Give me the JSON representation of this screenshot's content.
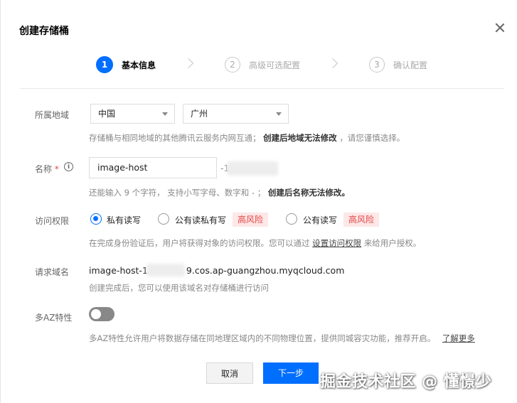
{
  "dialog": {
    "title": "创建存储桶"
  },
  "steps": [
    {
      "num": "1",
      "label": "基本信息"
    },
    {
      "num": "2",
      "label": "高级可选配置"
    },
    {
      "num": "3",
      "label": "确认配置"
    }
  ],
  "region": {
    "label": "所属地域",
    "country_value": "中国",
    "city_value": "广州",
    "hint_pre": "存储桶与相同地域的其他腾讯云服务内网互通；",
    "hint_bold": "创建后地域无法修改",
    "hint_post": "，请您谨慎选择。"
  },
  "name": {
    "label": "名称",
    "required_mark": "*",
    "info_glyph": "i",
    "value": "image-host",
    "suffix": "-1",
    "hint_pre": "还能输入 9 个字符， 支持小写字母、数字和 - ；",
    "hint_bold": "创建后名称无法修改。"
  },
  "access": {
    "label": "访问权限",
    "options": [
      {
        "label": "私有读写",
        "risk": ""
      },
      {
        "label": "公有读私有写",
        "risk": "高风险"
      },
      {
        "label": "公有读写",
        "risk": "高风险"
      }
    ],
    "hint_pre": "在完成身份验证后，用户将获得对象的访问权限。您可以通过",
    "hint_link": "设置访问权限",
    "hint_post": "来给用户授权。"
  },
  "domain": {
    "label": "请求域名",
    "value_pre": "image-host-1",
    "value_post": "9.cos.ap-guangzhou.myqcloud.com",
    "hint": "创建完成后，您可以使用该域名对存储桶进行访问"
  },
  "multi_az": {
    "label": "多AZ特性",
    "enabled": false,
    "hint": "多AZ特性允许用户将数据存储在同地理区域内的不同物理位置，提供同城容灾功能，推荐开启。",
    "link": "了解更多"
  },
  "footer": {
    "cancel_label": "取消",
    "next_label": "下一步"
  },
  "watermark": "掘金技术社区 @ 懂憬少",
  "colors": {
    "primary": "#006eff",
    "risk_bg": "#fde7e7",
    "risk_text": "#e54545"
  }
}
